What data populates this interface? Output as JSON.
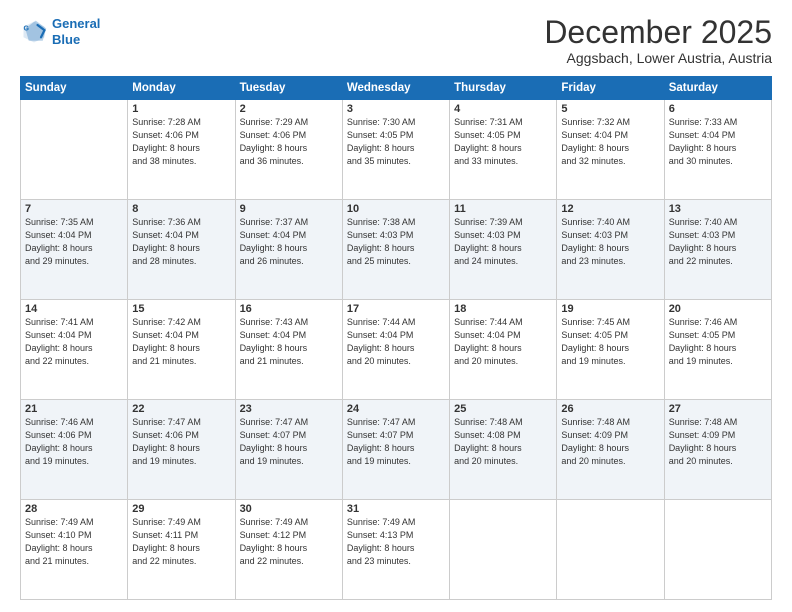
{
  "header": {
    "logo_line1": "General",
    "logo_line2": "Blue",
    "title": "December 2025",
    "subtitle": "Aggsbach, Lower Austria, Austria"
  },
  "weekdays": [
    "Sunday",
    "Monday",
    "Tuesday",
    "Wednesday",
    "Thursday",
    "Friday",
    "Saturday"
  ],
  "weeks": [
    [
      {
        "day": "",
        "info": ""
      },
      {
        "day": "1",
        "info": "Sunrise: 7:28 AM\nSunset: 4:06 PM\nDaylight: 8 hours\nand 38 minutes."
      },
      {
        "day": "2",
        "info": "Sunrise: 7:29 AM\nSunset: 4:06 PM\nDaylight: 8 hours\nand 36 minutes."
      },
      {
        "day": "3",
        "info": "Sunrise: 7:30 AM\nSunset: 4:05 PM\nDaylight: 8 hours\nand 35 minutes."
      },
      {
        "day": "4",
        "info": "Sunrise: 7:31 AM\nSunset: 4:05 PM\nDaylight: 8 hours\nand 33 minutes."
      },
      {
        "day": "5",
        "info": "Sunrise: 7:32 AM\nSunset: 4:04 PM\nDaylight: 8 hours\nand 32 minutes."
      },
      {
        "day": "6",
        "info": "Sunrise: 7:33 AM\nSunset: 4:04 PM\nDaylight: 8 hours\nand 30 minutes."
      }
    ],
    [
      {
        "day": "7",
        "info": "Sunrise: 7:35 AM\nSunset: 4:04 PM\nDaylight: 8 hours\nand 29 minutes."
      },
      {
        "day": "8",
        "info": "Sunrise: 7:36 AM\nSunset: 4:04 PM\nDaylight: 8 hours\nand 28 minutes."
      },
      {
        "day": "9",
        "info": "Sunrise: 7:37 AM\nSunset: 4:04 PM\nDaylight: 8 hours\nand 26 minutes."
      },
      {
        "day": "10",
        "info": "Sunrise: 7:38 AM\nSunset: 4:03 PM\nDaylight: 8 hours\nand 25 minutes."
      },
      {
        "day": "11",
        "info": "Sunrise: 7:39 AM\nSunset: 4:03 PM\nDaylight: 8 hours\nand 24 minutes."
      },
      {
        "day": "12",
        "info": "Sunrise: 7:40 AM\nSunset: 4:03 PM\nDaylight: 8 hours\nand 23 minutes."
      },
      {
        "day": "13",
        "info": "Sunrise: 7:40 AM\nSunset: 4:03 PM\nDaylight: 8 hours\nand 22 minutes."
      }
    ],
    [
      {
        "day": "14",
        "info": "Sunrise: 7:41 AM\nSunset: 4:04 PM\nDaylight: 8 hours\nand 22 minutes."
      },
      {
        "day": "15",
        "info": "Sunrise: 7:42 AM\nSunset: 4:04 PM\nDaylight: 8 hours\nand 21 minutes."
      },
      {
        "day": "16",
        "info": "Sunrise: 7:43 AM\nSunset: 4:04 PM\nDaylight: 8 hours\nand 21 minutes."
      },
      {
        "day": "17",
        "info": "Sunrise: 7:44 AM\nSunset: 4:04 PM\nDaylight: 8 hours\nand 20 minutes."
      },
      {
        "day": "18",
        "info": "Sunrise: 7:44 AM\nSunset: 4:04 PM\nDaylight: 8 hours\nand 20 minutes."
      },
      {
        "day": "19",
        "info": "Sunrise: 7:45 AM\nSunset: 4:05 PM\nDaylight: 8 hours\nand 19 minutes."
      },
      {
        "day": "20",
        "info": "Sunrise: 7:46 AM\nSunset: 4:05 PM\nDaylight: 8 hours\nand 19 minutes."
      }
    ],
    [
      {
        "day": "21",
        "info": "Sunrise: 7:46 AM\nSunset: 4:06 PM\nDaylight: 8 hours\nand 19 minutes."
      },
      {
        "day": "22",
        "info": "Sunrise: 7:47 AM\nSunset: 4:06 PM\nDaylight: 8 hours\nand 19 minutes."
      },
      {
        "day": "23",
        "info": "Sunrise: 7:47 AM\nSunset: 4:07 PM\nDaylight: 8 hours\nand 19 minutes."
      },
      {
        "day": "24",
        "info": "Sunrise: 7:47 AM\nSunset: 4:07 PM\nDaylight: 8 hours\nand 19 minutes."
      },
      {
        "day": "25",
        "info": "Sunrise: 7:48 AM\nSunset: 4:08 PM\nDaylight: 8 hours\nand 20 minutes."
      },
      {
        "day": "26",
        "info": "Sunrise: 7:48 AM\nSunset: 4:09 PM\nDaylight: 8 hours\nand 20 minutes."
      },
      {
        "day": "27",
        "info": "Sunrise: 7:48 AM\nSunset: 4:09 PM\nDaylight: 8 hours\nand 20 minutes."
      }
    ],
    [
      {
        "day": "28",
        "info": "Sunrise: 7:49 AM\nSunset: 4:10 PM\nDaylight: 8 hours\nand 21 minutes."
      },
      {
        "day": "29",
        "info": "Sunrise: 7:49 AM\nSunset: 4:11 PM\nDaylight: 8 hours\nand 22 minutes."
      },
      {
        "day": "30",
        "info": "Sunrise: 7:49 AM\nSunset: 4:12 PM\nDaylight: 8 hours\nand 22 minutes."
      },
      {
        "day": "31",
        "info": "Sunrise: 7:49 AM\nSunset: 4:13 PM\nDaylight: 8 hours\nand 23 minutes."
      },
      {
        "day": "",
        "info": ""
      },
      {
        "day": "",
        "info": ""
      },
      {
        "day": "",
        "info": ""
      }
    ]
  ]
}
